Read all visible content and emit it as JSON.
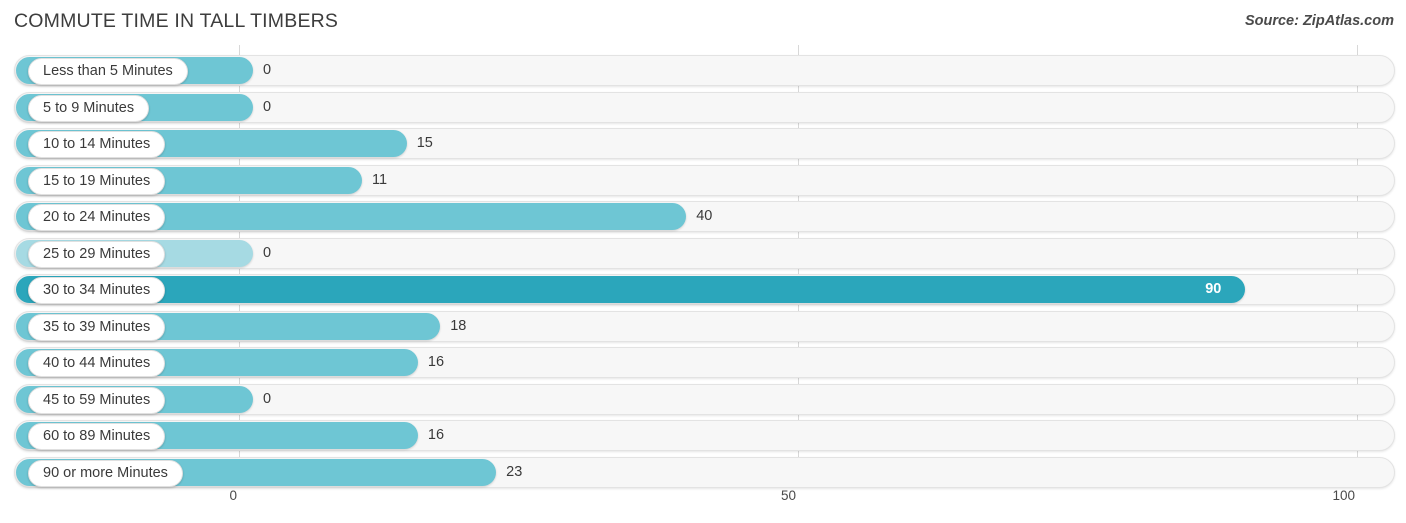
{
  "header": {
    "title": "COMMUTE TIME IN TALL TIMBERS",
    "source": "Source: ZipAtlas.com"
  },
  "colors": {
    "bar_default": "#6ec6d4",
    "bar_highlight_dark": "#2ba6bb",
    "bar_muted_light": "#a6dae3",
    "track": "#f7f7f7",
    "gridline": "#d8d8d8",
    "text": "#3a3a3a"
  },
  "chart_data": {
    "type": "bar",
    "orientation": "horizontal",
    "title": "COMMUTE TIME IN TALL TIMBERS",
    "subtitle": "",
    "xlabel": "",
    "ylabel": "",
    "xlim": [
      0,
      100
    ],
    "xticks": [
      0,
      50,
      100
    ],
    "xtick_labels": [
      "0",
      "50",
      "100"
    ],
    "grid": true,
    "legend": false,
    "source": "Source: ZipAtlas.com",
    "categories": [
      "Less than 5 Minutes",
      "5 to 9 Minutes",
      "10 to 14 Minutes",
      "15 to 19 Minutes",
      "20 to 24 Minutes",
      "25 to 29 Minutes",
      "30 to 34 Minutes",
      "35 to 39 Minutes",
      "40 to 44 Minutes",
      "45 to 59 Minutes",
      "60 to 89 Minutes",
      "90 or more Minutes"
    ],
    "values": [
      0,
      0,
      15,
      11,
      40,
      0,
      90,
      18,
      16,
      0,
      16,
      23
    ],
    "value_labels": [
      "0",
      "0",
      "15",
      "11",
      "40",
      "0",
      "90",
      "18",
      "16",
      "0",
      "16",
      "23"
    ]
  },
  "rows": [
    {
      "label": "Less than 5 Minutes",
      "value": 0,
      "value_label": "0",
      "style": "default",
      "label_inside": false
    },
    {
      "label": "5 to 9 Minutes",
      "value": 0,
      "value_label": "0",
      "style": "default",
      "label_inside": false
    },
    {
      "label": "10 to 14 Minutes",
      "value": 15,
      "value_label": "15",
      "style": "default",
      "label_inside": false
    },
    {
      "label": "15 to 19 Minutes",
      "value": 11,
      "value_label": "11",
      "style": "default",
      "label_inside": false
    },
    {
      "label": "20 to 24 Minutes",
      "value": 40,
      "value_label": "40",
      "style": "default",
      "label_inside": false
    },
    {
      "label": "25 to 29 Minutes",
      "value": 0,
      "value_label": "0",
      "style": "light",
      "label_inside": false
    },
    {
      "label": "30 to 34 Minutes",
      "value": 90,
      "value_label": "90",
      "style": "dark",
      "label_inside": true
    },
    {
      "label": "35 to 39 Minutes",
      "value": 18,
      "value_label": "18",
      "style": "default",
      "label_inside": false
    },
    {
      "label": "40 to 44 Minutes",
      "value": 16,
      "value_label": "16",
      "style": "default",
      "label_inside": false
    },
    {
      "label": "45 to 59 Minutes",
      "value": 0,
      "value_label": "0",
      "style": "default",
      "label_inside": false
    },
    {
      "label": "60 to 89 Minutes",
      "value": 16,
      "value_label": "16",
      "style": "default",
      "label_inside": false
    },
    {
      "label": "90 or more Minutes",
      "value": 23,
      "value_label": "23",
      "style": "default",
      "label_inside": false
    }
  ],
  "axis": {
    "ticks": [
      {
        "label": "0",
        "value": 0
      },
      {
        "label": "50",
        "value": 50
      },
      {
        "label": "100",
        "value": 100
      }
    ]
  }
}
